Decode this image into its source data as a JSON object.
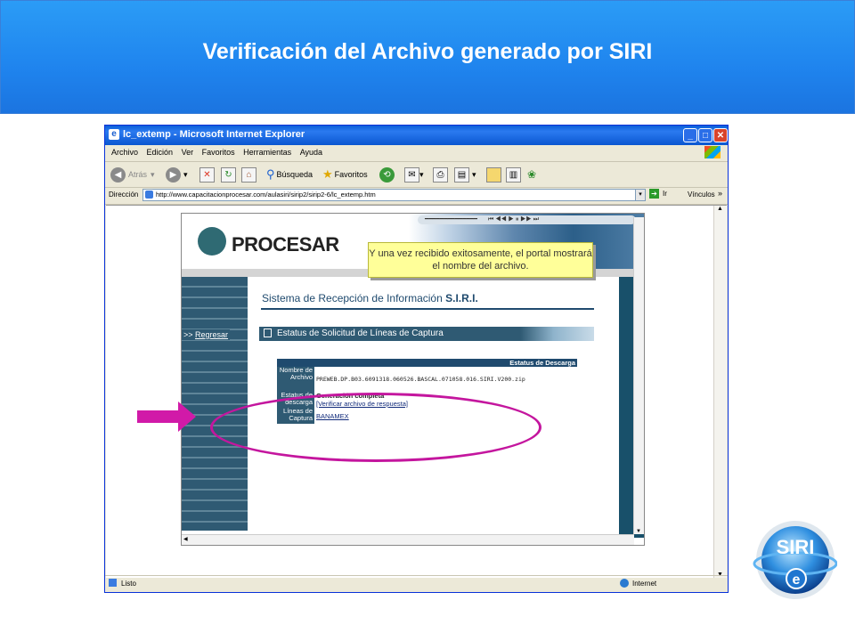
{
  "slide": {
    "title": "Verificación del Archivo generado por SIRI"
  },
  "browser": {
    "window_title": "lc_extemp - Microsoft Internet Explorer",
    "menu": [
      "Archivo",
      "Edición",
      "Ver",
      "Favoritos",
      "Herramientas",
      "Ayuda"
    ],
    "toolbar": {
      "back": "Atrás",
      "search": "Búsqueda",
      "favorites": "Favoritos"
    },
    "address_label": "Dirección",
    "address_url": "http://www.capacitacionprocesar.com/aulasiri/sirip2/sirip2-6/lc_extemp.htm",
    "go_label": "Ir",
    "links_label": "Vínculos",
    "status_left": "Listo",
    "status_zone": "Internet"
  },
  "page": {
    "logo_text": "PROCESAR",
    "back_arrow": ">>",
    "back_link": "Regresar",
    "system_title_prefix": "Sistema de Recepción de Información",
    "system_title_bold": "S.I.R.I.",
    "status_header": "Estatus de Solicitud de Líneas de Captura",
    "table": {
      "header": "Estatus de Descarga",
      "file_label": "Nombre de Archivo",
      "file_name": "PREWEB.DP.B03.6091318.060526.BASCAL.071058.016.SIRI.V200.zip",
      "download_label": "Estatus de descarga",
      "download_status": "Generación completa",
      "verify_link": "[Verificar archivo de respuesta]",
      "lines_label": "Líneas de Captura",
      "bank": "BANAMEX"
    }
  },
  "callout": {
    "text": "Y una vez recibido exitosamente, el portal mostrará el nombre del archivo."
  },
  "colors": {
    "header_blue": "#1f84ee",
    "highlight_magenta": "#c4169e",
    "callout_yellow": "#ffff99",
    "page_teal": "#2f5a73"
  }
}
